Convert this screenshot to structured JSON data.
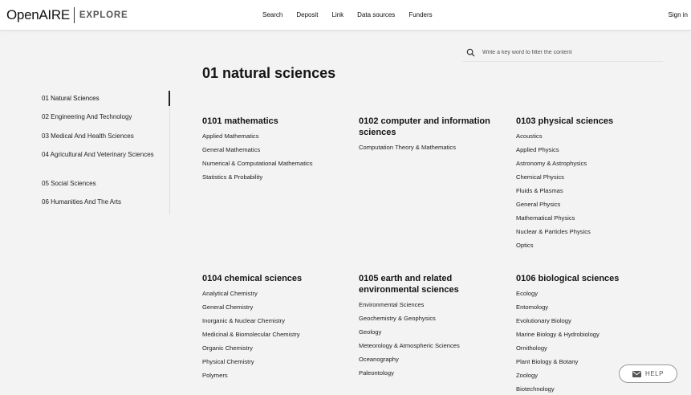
{
  "header": {
    "logo_main": "OpenAIRE",
    "logo_sub": "EXPLORE",
    "nav": [
      "Search",
      "Deposit",
      "Link",
      "Data sources",
      "Funders"
    ],
    "sign_in": "Sign in"
  },
  "search": {
    "placeholder": "Write a key word to filter the content",
    "value": ""
  },
  "page_title": "01 natural sciences",
  "sidebar": {
    "items": [
      "01 Natural Sciences",
      "02 Engineering And Technology",
      "03 Medical And Health Sciences",
      "04 Agricultural And Veterinary Sciences",
      "05 Social Sciences",
      "06 Humanities And The Arts"
    ],
    "active_index": 0
  },
  "categories": [
    {
      "title": "0101 mathematics",
      "items": [
        "Applied Mathematics",
        "General Mathematics",
        "Numerical & Computational Mathematics",
        "Statistics & Probability"
      ]
    },
    {
      "title": "0102 computer and information sciences",
      "items": [
        "Computation Theory & Mathematics"
      ]
    },
    {
      "title": "0103 physical sciences",
      "items": [
        "Acoustics",
        "Applied Physics",
        "Astronomy & Astrophysics",
        "Chemical Physics",
        "Fluids & Plasmas",
        "General Physics",
        "Mathematical Physics",
        "Nuclear & Particles Physics",
        "Optics"
      ]
    },
    {
      "title": "0104 chemical sciences",
      "items": [
        "Analytical Chemistry",
        "General Chemistry",
        "Inorganic & Nuclear Chemistry",
        "Medicinal & Biomolecular Chemistry",
        "Organic Chemistry",
        "Physical Chemistry",
        "Polymers"
      ]
    },
    {
      "title": "0105 earth and related environmental sciences",
      "items": [
        "Environmental Sciences",
        "Geochemistry & Geophysics",
        "Geology",
        "Meteorology & Atmospheric Sciences",
        "Oceanography",
        "Paleontology"
      ]
    },
    {
      "title": "0106 biological sciences",
      "items": [
        "Ecology",
        "Entomology",
        "Evolutionary Biology",
        "Marine Biology & Hydrobiology",
        "Ornithology",
        "Plant Biology & Botany",
        "Zoology",
        "Biotechnology"
      ]
    }
  ],
  "help": {
    "label": "HELP",
    "icon": "mail-icon"
  }
}
